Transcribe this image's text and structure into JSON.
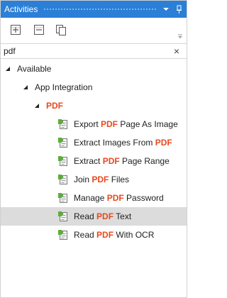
{
  "panel": {
    "title": "Activities"
  },
  "search": {
    "value": "pdf",
    "clear_glyph": "×"
  },
  "tree": {
    "root_label": "Available",
    "group_label": "App Integration",
    "category_label": "PDF",
    "activities": [
      {
        "pre": "Export ",
        "match": "PDF",
        "post": " Page As Image",
        "selected": false
      },
      {
        "pre": "Extract Images From ",
        "match": "PDF",
        "post": "",
        "selected": false
      },
      {
        "pre": "Extract ",
        "match": "PDF",
        "post": " Page Range",
        "selected": false
      },
      {
        "pre": "Join ",
        "match": "PDF",
        "post": " Files",
        "selected": false
      },
      {
        "pre": "Manage ",
        "match": "PDF",
        "post": " Password",
        "selected": false
      },
      {
        "pre": "Read ",
        "match": "PDF",
        "post": " Text",
        "selected": true
      },
      {
        "pre": "Read ",
        "match": "PDF",
        "post": " With OCR",
        "selected": false
      }
    ]
  },
  "colors": {
    "titlebar": "#2b7fd6",
    "highlight": "#e8491d",
    "selection": "#dcdcdc",
    "activity_icon_green": "#5cae3a"
  },
  "icons": {
    "pin": "pin-icon",
    "dropdown": "dropdown-icon",
    "expand_all": "expand-all-icon",
    "collapse_all": "collapse-all-icon",
    "copy": "copy-icon",
    "tree_arrow": "expanded-arrow-icon",
    "activity": "activity-icon"
  }
}
